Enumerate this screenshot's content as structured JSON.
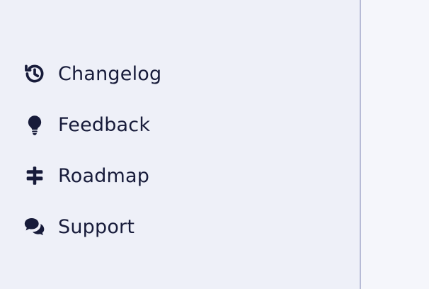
{
  "sidebar": {
    "items": [
      {
        "label": "Changelog",
        "icon": "history-icon"
      },
      {
        "label": "Feedback",
        "icon": "lightbulb-icon"
      },
      {
        "label": "Roadmap",
        "icon": "signpost-icon"
      },
      {
        "label": "Support",
        "icon": "chat-bubbles-icon"
      }
    ]
  },
  "colors": {
    "sidebar_bg": "#eef0f8",
    "main_bg": "#f5f6fb",
    "divider": "#b7bbd6",
    "text": "#171b3a"
  }
}
